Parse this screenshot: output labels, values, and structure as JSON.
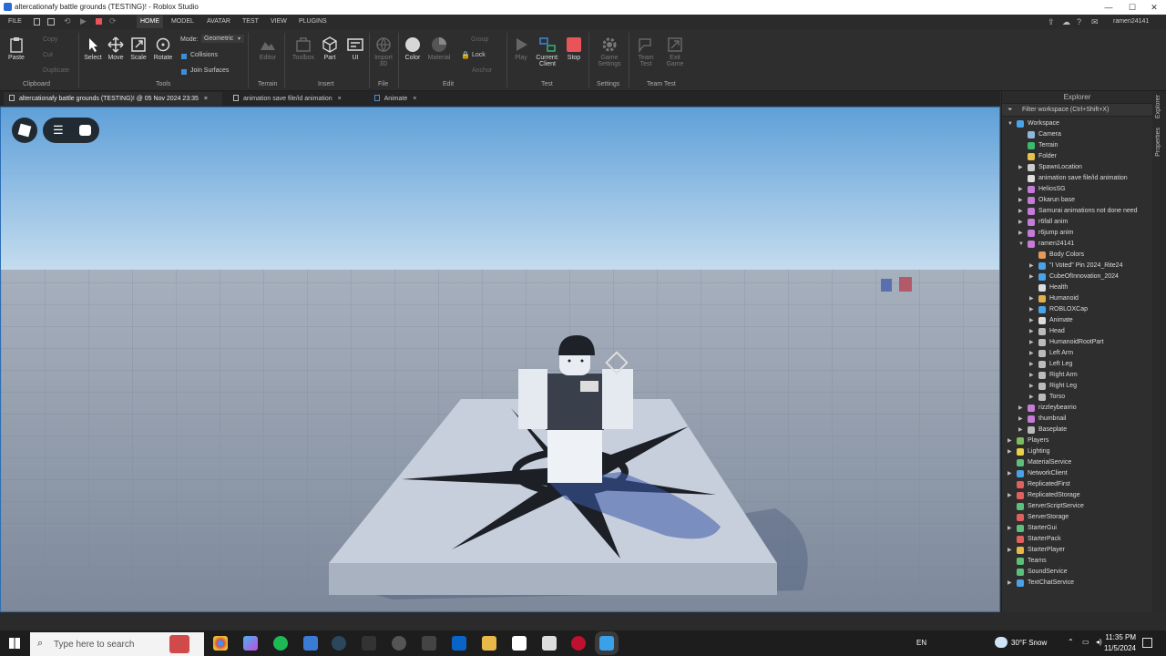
{
  "window": {
    "title": "altercationafy battle grounds (TESTING)! - Roblox Studio",
    "min": "—",
    "max": "☐",
    "close": "✕"
  },
  "menu": {
    "file": "FILE",
    "home": "HOME",
    "model": "MODEL",
    "avatar": "AVATAR",
    "test": "TEST",
    "view": "VIEW",
    "plugins": "PLUGINS",
    "user": "ramen24141"
  },
  "ribbon": {
    "clipboard": {
      "paste": "Paste",
      "copy": "Copy",
      "cut": "Cut",
      "duplicate": "Duplicate",
      "group": "Clipboard"
    },
    "tools": {
      "select": "Select",
      "move": "Move",
      "scale": "Scale",
      "rotate": "Rotate",
      "mode_label": "Mode:",
      "mode_value": "Geometric",
      "collisions": "Collisions",
      "join_surfaces": "Join Surfaces",
      "group": "Tools"
    },
    "terrain": {
      "editor": "Editor",
      "group": "Terrain"
    },
    "insert": {
      "toolbox": "Toolbox",
      "part": "Part",
      "ui": "UI",
      "group": "Insert"
    },
    "file": {
      "import3d_a": "Import",
      "import3d_b": "3D",
      "group": "File"
    },
    "edit": {
      "color": "Color",
      "material": "Material",
      "group_btn": "Group",
      "lock": "Lock",
      "anchor": "Anchor",
      "group": "Edit"
    },
    "test": {
      "play": "Play",
      "current_a": "Current:",
      "current_b": "Client",
      "stop": "Stop",
      "group": "Test"
    },
    "settings": {
      "game_a": "Game",
      "game_b": "Settings",
      "group": "Settings"
    },
    "teamtest": {
      "team_a": "Team",
      "team_b": "Test",
      "exit_a": "Exit",
      "exit_b": "Game",
      "group": "Team Test"
    }
  },
  "tabs": [
    {
      "label": "altercationafy battle grounds (TESTING)! @ 05 Nov 2024 23:35",
      "close": "×"
    },
    {
      "label": "animation save file/id animation",
      "close": "×"
    },
    {
      "label": "Animate",
      "close": "×"
    }
  ],
  "explorer": {
    "title": "Explorer",
    "filter": "Filter workspace (Ctrl+Shift+X)",
    "items": [
      {
        "label": "Workspace",
        "arrow": "▼"
      },
      {
        "label": "Camera",
        "arrow": ""
      },
      {
        "label": "Terrain",
        "arrow": ""
      },
      {
        "label": "Folder",
        "arrow": ""
      },
      {
        "label": "SpawnLocation",
        "arrow": "▶"
      },
      {
        "label": "animation save file/id animation",
        "arrow": ""
      },
      {
        "label": "HeliosSG",
        "arrow": "▶"
      },
      {
        "label": "Okarun base",
        "arrow": "▶"
      },
      {
        "label": "Samurai animations not done need",
        "arrow": "▶"
      },
      {
        "label": "r6fall anim",
        "arrow": "▶"
      },
      {
        "label": "r6jump anim",
        "arrow": "▶"
      },
      {
        "label": "ramen24141",
        "arrow": "▼"
      },
      {
        "label": "Body Colors",
        "arrow": ""
      },
      {
        "label": "\"I Voted\" Pin 2024_Rite24",
        "arrow": "▶"
      },
      {
        "label": "CubeOfInnovation_2024",
        "arrow": "▶"
      },
      {
        "label": "Health",
        "arrow": ""
      },
      {
        "label": "Humanoid",
        "arrow": "▶"
      },
      {
        "label": "ROBLOXCap",
        "arrow": "▶"
      },
      {
        "label": "Animate",
        "arrow": "▶"
      },
      {
        "label": "Head",
        "arrow": "▶"
      },
      {
        "label": "HumanoidRootPart",
        "arrow": "▶"
      },
      {
        "label": "Left Arm",
        "arrow": "▶"
      },
      {
        "label": "Left Leg",
        "arrow": "▶"
      },
      {
        "label": "Right Arm",
        "arrow": "▶"
      },
      {
        "label": "Right Leg",
        "arrow": "▶"
      },
      {
        "label": "Torso",
        "arrow": "▶"
      },
      {
        "label": "rizzleybearrio",
        "arrow": "▶"
      },
      {
        "label": "thumbnail",
        "arrow": "▶"
      },
      {
        "label": "Baseplate",
        "arrow": "▶"
      },
      {
        "label": "Players",
        "arrow": "▶"
      },
      {
        "label": "Lighting",
        "arrow": "▶"
      },
      {
        "label": "MaterialService",
        "arrow": ""
      },
      {
        "label": "NetworkClient",
        "arrow": "▶"
      },
      {
        "label": "ReplicatedFirst",
        "arrow": ""
      },
      {
        "label": "ReplicatedStorage",
        "arrow": "▶"
      },
      {
        "label": "ServerScriptService",
        "arrow": ""
      },
      {
        "label": "ServerStorage",
        "arrow": ""
      },
      {
        "label": "StarterGui",
        "arrow": "▶"
      },
      {
        "label": "StarterPack",
        "arrow": ""
      },
      {
        "label": "StarterPlayer",
        "arrow": "▶"
      },
      {
        "label": "Teams",
        "arrow": ""
      },
      {
        "label": "SoundService",
        "arrow": ""
      },
      {
        "label": "TextChatService",
        "arrow": "▶"
      }
    ]
  },
  "sidestrip": {
    "explorer": "Explorer",
    "properties": "Properties"
  },
  "taskbar": {
    "search_placeholder": "Type here to search",
    "lang": "EN",
    "weather": "30°F  Snow",
    "time": "11:35 PM",
    "date": "11/5/2024"
  },
  "colors": {
    "accent": "#2d6fb5",
    "stop": "#e8545a",
    "sky_top": "#5fa0d8",
    "sky_horizon": "#c4dcef",
    "ground": "#8b97a8"
  }
}
